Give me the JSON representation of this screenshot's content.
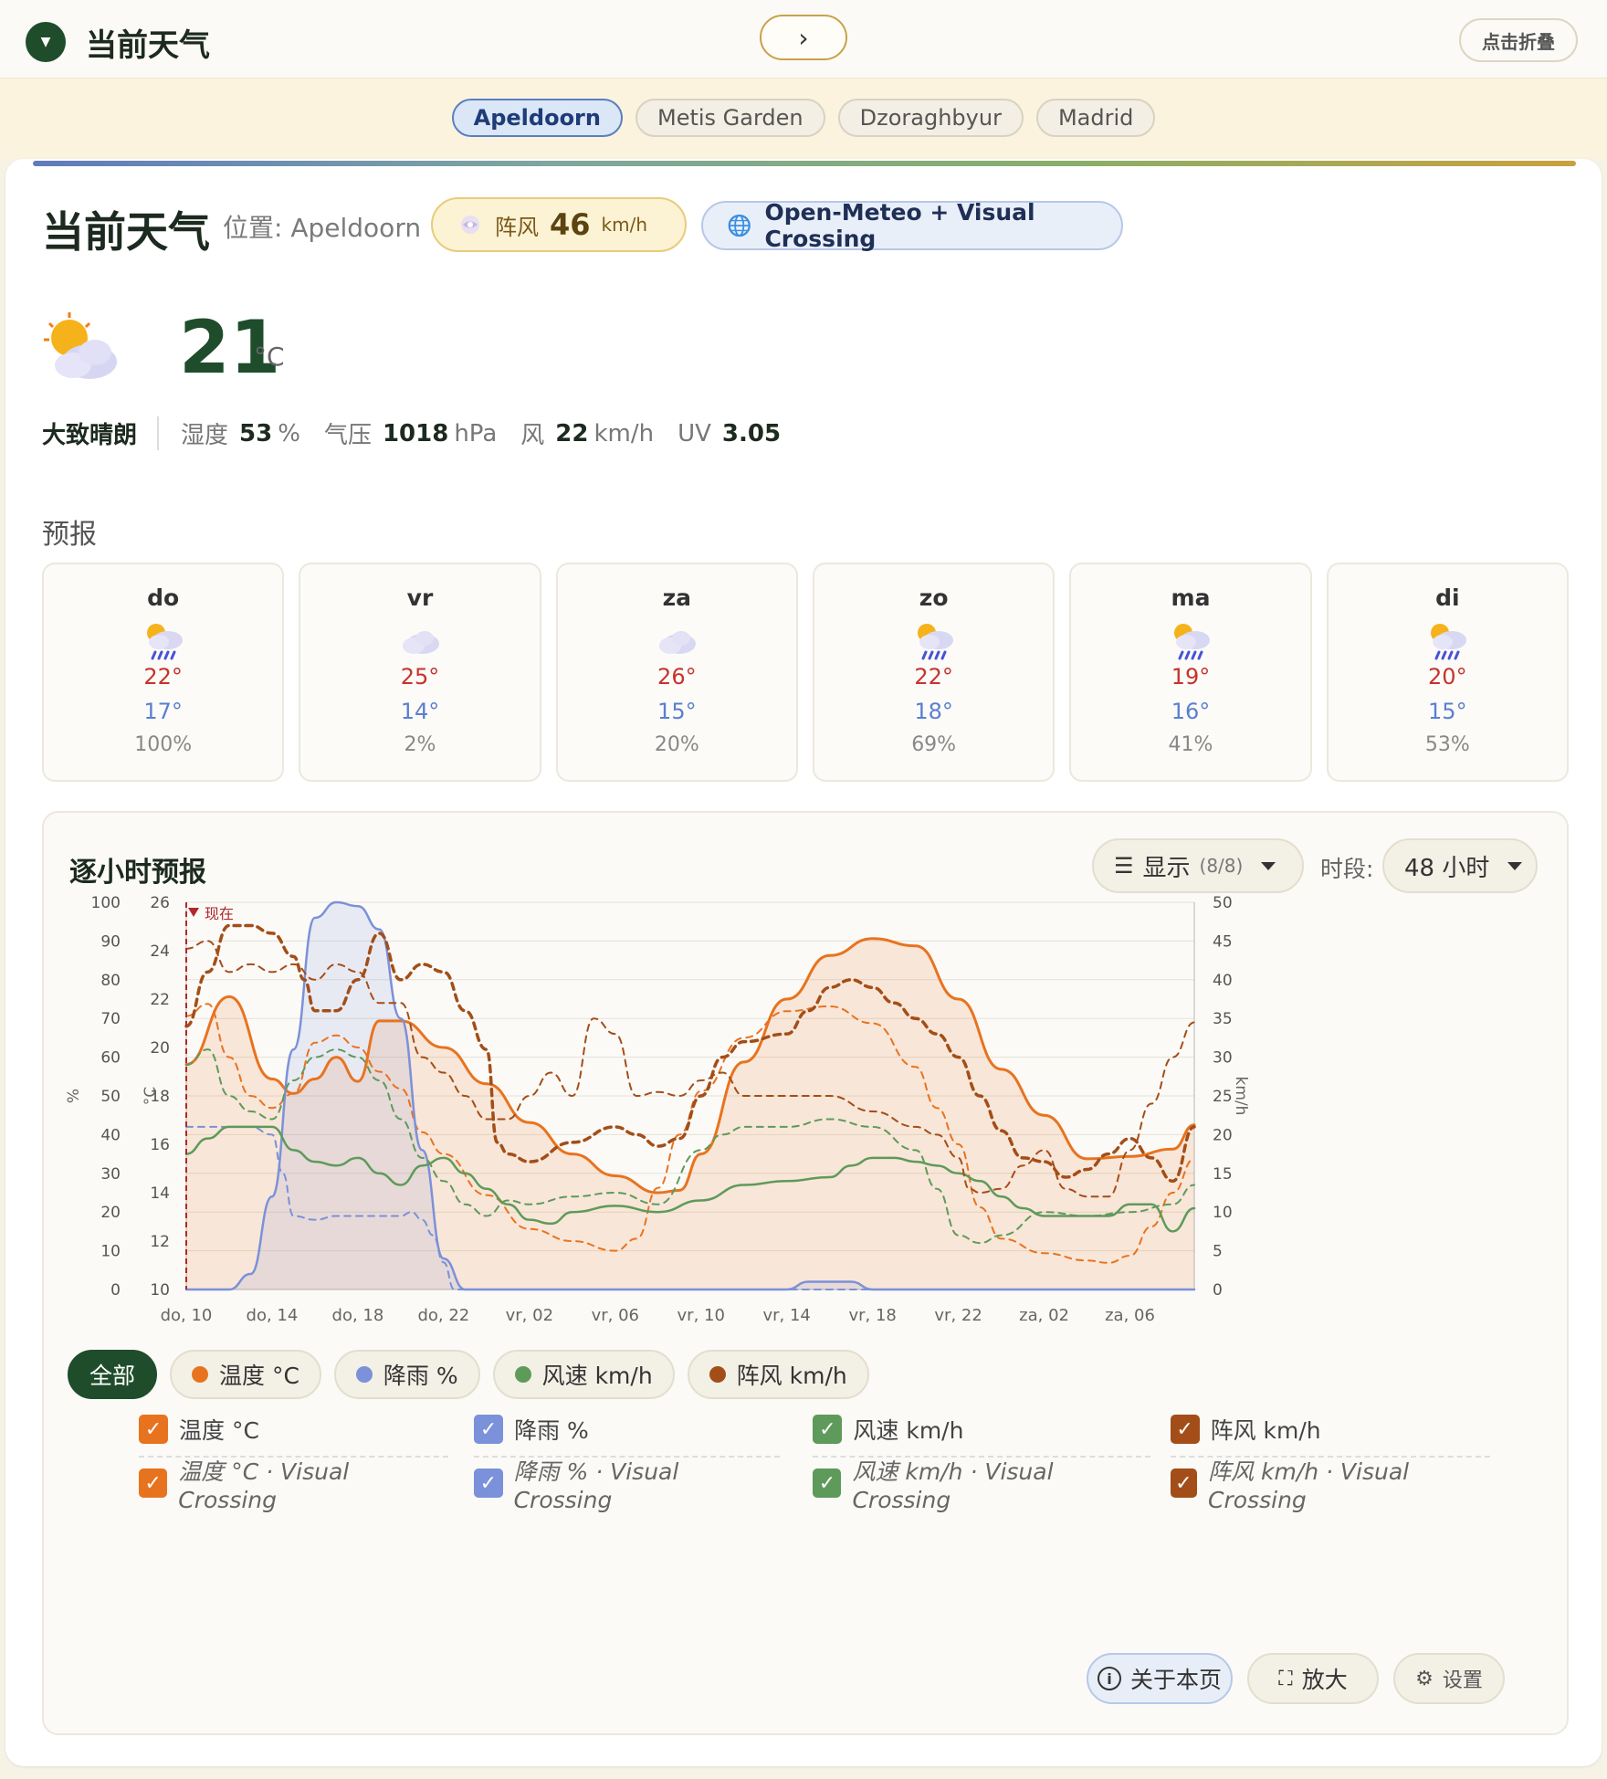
{
  "header": {
    "title": "当前天气",
    "next_label": "›",
    "fold_label": "点击折叠"
  },
  "cities": [
    {
      "label": "Apeldoorn",
      "active": true
    },
    {
      "label": "Metis Garden",
      "active": false
    },
    {
      "label": "Dzoraghbyur",
      "active": false
    },
    {
      "label": "Madrid",
      "active": false
    }
  ],
  "current": {
    "title": "当前天气",
    "location_label": "位置:",
    "location": "Apeldoorn",
    "gust_label": "阵风",
    "gust_value": "46",
    "gust_unit": "km/h",
    "source": "Open-Meteo + Visual Crossing",
    "temperature": "21",
    "temperature_unit": "°C",
    "condition": "大致晴朗",
    "humidity_label": "湿度",
    "humidity": "53",
    "humidity_unit": "%",
    "pressure_label": "气压",
    "pressure": "1018",
    "pressure_unit": "hPa",
    "wind_label": "风",
    "wind": "22",
    "wind_unit": "km/h",
    "uv_label": "UV",
    "uv": "3.05"
  },
  "forecast": {
    "title": "预报",
    "days": [
      {
        "day": "do",
        "icon": "sun-rain-icon",
        "hi": "22°",
        "lo": "17°",
        "precip": "100%"
      },
      {
        "day": "vr",
        "icon": "cloud-icon",
        "hi": "25°",
        "lo": "14°",
        "precip": "2%"
      },
      {
        "day": "za",
        "icon": "cloud-icon",
        "hi": "26°",
        "lo": "15°",
        "precip": "20%"
      },
      {
        "day": "zo",
        "icon": "sun-rain-icon",
        "hi": "22°",
        "lo": "18°",
        "precip": "69%"
      },
      {
        "day": "ma",
        "icon": "sun-rain-icon",
        "hi": "19°",
        "lo": "16°",
        "precip": "41%"
      },
      {
        "day": "di",
        "icon": "sun-rain-icon",
        "hi": "20°",
        "lo": "15°",
        "precip": "53%"
      }
    ]
  },
  "hourly": {
    "title": "逐小时预报",
    "show_label": "显示",
    "show_count": "(8/8)",
    "period_label": "时段:",
    "period_value": "48 小时"
  },
  "chart_data": {
    "type": "line",
    "now_label": "现在",
    "x_ticks": [
      "do, 10",
      "do, 14",
      "do, 18",
      "do, 22",
      "vr, 02",
      "vr, 06",
      "vr, 10",
      "vr, 14",
      "vr, 18",
      "vr, 22",
      "za, 02",
      "za, 06"
    ],
    "x_hours": [
      0,
      4,
      8,
      12,
      16,
      20,
      24,
      28,
      32,
      36,
      40,
      44
    ],
    "xlim": [
      0,
      47
    ],
    "now_hour": 0,
    "y_left_pct": {
      "label": "%",
      "ticks": [
        0,
        10,
        20,
        30,
        40,
        50,
        60,
        70,
        80,
        90,
        100
      ],
      "ylim": [
        0,
        100
      ]
    },
    "y_left_temp": {
      "label": "°C",
      "ticks": [
        10,
        12,
        14,
        16,
        18,
        20,
        22,
        24,
        26
      ],
      "ylim": [
        10,
        26
      ]
    },
    "y_right_kmh": {
      "label": "km/h",
      "ticks": [
        0,
        5,
        10,
        15,
        20,
        25,
        30,
        35,
        40,
        45,
        50
      ],
      "ylim": [
        0,
        50
      ]
    },
    "series": [
      {
        "name": "温度 °C",
        "axis": "temp",
        "color": "#e8731f",
        "dashed": false,
        "fill": true,
        "width": 3,
        "x": [
          0,
          2,
          4,
          5,
          6,
          7,
          8,
          9,
          10,
          12,
          14,
          16,
          18,
          20,
          22,
          23,
          24,
          26,
          28,
          30,
          32,
          34,
          36,
          38,
          40,
          42,
          44,
          46,
          47
        ],
        "y": [
          19.3,
          22.1,
          18.7,
          18.1,
          18.7,
          19.6,
          18.6,
          21.1,
          21.1,
          20,
          18.5,
          16.9,
          15.6,
          14.7,
          14.0,
          14.1,
          15.6,
          19.4,
          22.0,
          23.8,
          24.5,
          24.2,
          22.0,
          19.1,
          17.2,
          15.4,
          15.5,
          15.8,
          16.8
        ]
      },
      {
        "name": "温度 °C · Visual Crossing",
        "axis": "temp",
        "color": "#e8731f",
        "dashed": true,
        "fill": false,
        "width": 2,
        "x": [
          0,
          1,
          2,
          3,
          4,
          5,
          6,
          7,
          8,
          9,
          10,
          11,
          12,
          14,
          16,
          18,
          20,
          21,
          22,
          23,
          24,
          26,
          28,
          30,
          32,
          34,
          35,
          36,
          37,
          38,
          40,
          42,
          43,
          44,
          45,
          46,
          47
        ],
        "y": [
          21.3,
          21.8,
          19.6,
          18.0,
          17.5,
          18.1,
          20.2,
          20.5,
          20.0,
          19.0,
          18.3,
          16.5,
          15.6,
          13.9,
          12.5,
          12.0,
          11.6,
          12.1,
          14.2,
          16.4,
          18.2,
          20.4,
          21.5,
          21.7,
          21.0,
          19.2,
          17.5,
          16.0,
          13.4,
          12.1,
          11.5,
          11.2,
          11.1,
          11.4,
          12.6,
          14.0,
          15.4
        ]
      },
      {
        "name": "降雨 %",
        "axis": "pct",
        "color": "#7b91d9",
        "dashed": false,
        "fill": true,
        "width": 2.5,
        "x": [
          0,
          1,
          2,
          3,
          4,
          5,
          6,
          7,
          8,
          9,
          10,
          11,
          12,
          13,
          14,
          16,
          20,
          24,
          28,
          29,
          30,
          31,
          32,
          36,
          40,
          47
        ],
        "y": [
          0,
          0,
          0,
          4,
          24,
          62,
          96,
          100,
          99,
          93,
          70,
          36,
          8,
          0,
          0,
          0,
          0,
          0,
          0,
          2,
          2,
          2,
          0,
          0,
          0,
          0
        ]
      },
      {
        "name": "降雨 % · Visual Crossing",
        "axis": "pct",
        "color": "#7b91d9",
        "dashed": true,
        "fill": false,
        "width": 2,
        "x": [
          0,
          1,
          2,
          3,
          4,
          4.5,
          5,
          6,
          7,
          8,
          9,
          10,
          10.5,
          11,
          11.5,
          12,
          12.5,
          13,
          20,
          30,
          40,
          47
        ],
        "y": [
          42,
          42,
          42,
          42,
          40,
          30,
          19,
          18,
          19,
          19,
          19,
          19,
          20,
          18,
          14,
          7,
          0,
          0,
          0,
          0,
          0,
          0
        ]
      },
      {
        "name": "风速 km/h",
        "axis": "kmh",
        "color": "#5e9a5a",
        "dashed": false,
        "fill": false,
        "width": 2.5,
        "x": [
          0,
          1,
          2,
          3,
          4,
          5,
          6,
          7,
          8,
          9,
          10,
          11,
          12,
          13,
          14,
          15,
          16,
          17,
          18,
          20,
          22,
          24,
          26,
          28,
          30,
          31,
          32,
          33,
          34,
          35,
          36,
          37,
          38,
          39,
          40,
          42,
          43,
          44,
          45,
          46,
          47
        ],
        "y": [
          17.5,
          19.5,
          21,
          21,
          21,
          18,
          16.5,
          16,
          17,
          15,
          13.5,
          16,
          17,
          15,
          13,
          11,
          9,
          8.5,
          10,
          10.8,
          10,
          11.5,
          13.5,
          14,
          14.5,
          16,
          17,
          17,
          16.5,
          16,
          15,
          14,
          12,
          10.5,
          9.5,
          9.5,
          9.5,
          11,
          11,
          7.5,
          10.5
        ]
      },
      {
        "name": "风速 km/h · Visual Crossing",
        "axis": "kmh",
        "color": "#5e9a5a",
        "dashed": true,
        "fill": false,
        "width": 2,
        "x": [
          0,
          1,
          2,
          3,
          4,
          5,
          6,
          7,
          8,
          9,
          10,
          11,
          12,
          13,
          14,
          15,
          16,
          18,
          20,
          22,
          24,
          25,
          26,
          28,
          30,
          32,
          34,
          35,
          36,
          37,
          38,
          40,
          42,
          44,
          46,
          47
        ],
        "y": [
          29,
          31,
          25,
          23,
          22,
          27,
          30,
          31,
          30,
          27,
          22,
          17,
          14,
          11,
          9.5,
          11.5,
          11,
          12,
          12.5,
          11,
          18,
          20,
          21,
          21,
          22,
          21,
          18,
          13,
          7,
          6,
          7,
          10,
          9.5,
          10,
          11,
          13.5
        ]
      },
      {
        "name": "阵风 km/h",
        "axis": "kmh",
        "color": "#a34e18",
        "dashed": true,
        "fill": false,
        "width": 3.5,
        "x": [
          0,
          1,
          2,
          3,
          4,
          5,
          5.5,
          6,
          7,
          8,
          9,
          10,
          11,
          12,
          13,
          14,
          14.5,
          15,
          16,
          18,
          20,
          21,
          22,
          23,
          24,
          25,
          26,
          28,
          29,
          30,
          31,
          32,
          33,
          34,
          35,
          36,
          37,
          38,
          39,
          40,
          41,
          42,
          43,
          44,
          45,
          46,
          47
        ],
        "y": [
          34,
          41,
          47,
          47,
          46,
          43,
          40,
          36,
          36,
          40,
          46,
          40,
          42,
          41,
          36,
          31,
          19,
          17.5,
          16.5,
          19,
          21,
          20,
          18.5,
          19.5,
          25,
          30,
          32,
          33,
          36,
          39,
          40,
          39,
          37,
          35,
          33,
          30,
          25,
          20.5,
          17,
          16.5,
          14.5,
          15.5,
          17.5,
          19.5,
          17,
          14,
          21
        ]
      },
      {
        "name": "阵风 km/h · Visual Crossing",
        "axis": "kmh",
        "color": "#a34e18",
        "dashed": true,
        "fill": false,
        "width": 2,
        "x": [
          0,
          1,
          2,
          3,
          4,
          5,
          6,
          7,
          8,
          9,
          10,
          11,
          12,
          13,
          14,
          15,
          16,
          17,
          18,
          19,
          20,
          21,
          22,
          23,
          24,
          25,
          26,
          28,
          30,
          32,
          34,
          35,
          36,
          36.5,
          37,
          38,
          39,
          40,
          41,
          42,
          43,
          44,
          45,
          46,
          47
        ],
        "y": [
          44,
          45,
          41,
          42,
          41,
          42,
          40,
          42,
          41,
          37,
          37,
          30,
          28,
          25,
          22,
          22,
          25,
          28,
          25,
          35,
          33,
          25,
          25.5,
          25,
          27,
          28,
          25,
          25,
          25,
          23,
          21,
          20,
          17,
          13,
          12.5,
          13,
          16,
          18,
          13,
          12,
          12,
          18,
          24,
          30,
          34.5
        ]
      }
    ]
  },
  "legend": {
    "all_label": "全部",
    "pills": [
      {
        "label": "温度 °C",
        "color": "#e8731f"
      },
      {
        "label": "降雨 %",
        "color": "#7b91d9"
      },
      {
        "label": "风速 km/h",
        "color": "#5e9a5a"
      },
      {
        "label": "阵风 km/h",
        "color": "#a34e18"
      }
    ],
    "checkboxes": [
      {
        "label": "温度 °C",
        "vc_label": "温度 °C · Visual Crossing",
        "color": "#e8731f"
      },
      {
        "label": "降雨 %",
        "vc_label": "降雨 % · Visual Crossing",
        "color": "#7b91d9"
      },
      {
        "label": "风速 km/h",
        "vc_label": "风速 km/h · Visual Crossing",
        "color": "#5e9a5a"
      },
      {
        "label": "阵风 km/h",
        "vc_label": "阵风 km/h · Visual Crossing",
        "color": "#a34e18"
      }
    ]
  },
  "footer": {
    "about_label": "关于本页",
    "zoom_label": "放大",
    "settings_label": "设置"
  }
}
